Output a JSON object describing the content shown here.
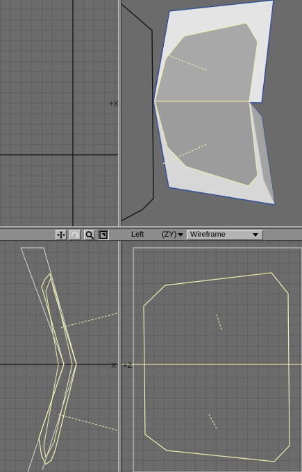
{
  "viewport_bottom_right": {
    "view_name": "Left",
    "axes": "(ZY)",
    "render_mode": "Wireframe"
  },
  "toolbar_icons": [
    "move-icon",
    "rotate-icon",
    "zoom-icon",
    "maximize-icon"
  ],
  "origin_markers": {
    "top_left": "+X",
    "bottom_left": "X",
    "bottom_right": "+Z"
  },
  "colors": {
    "background": "#6b6b6b",
    "grid": "#5e5e5e",
    "wireframe": "#f2f2b0",
    "selected_edge": "#3050a0",
    "dark_outline": "#1a1a1a"
  }
}
